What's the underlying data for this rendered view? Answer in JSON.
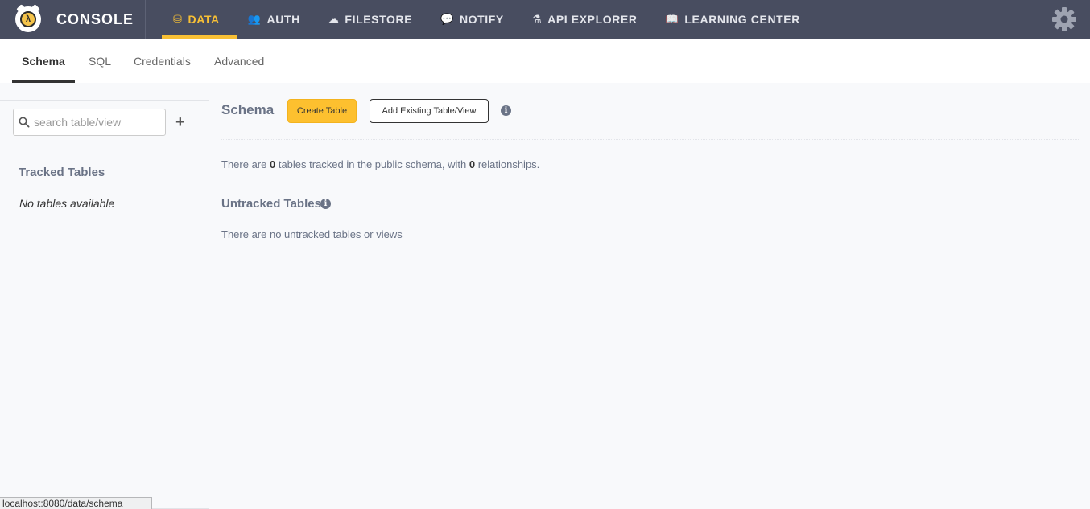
{
  "app": {
    "brand": "CONSOLE"
  },
  "topnav": [
    {
      "label": "DATA",
      "icon": "database-icon",
      "glyph": "⛁",
      "active": true
    },
    {
      "label": "AUTH",
      "icon": "users-icon",
      "glyph": "👥",
      "active": false
    },
    {
      "label": "FILESTORE",
      "icon": "cloud-upload-icon",
      "glyph": "☁",
      "active": false
    },
    {
      "label": "NOTIFY",
      "icon": "comment-icon",
      "glyph": "💬",
      "active": false
    },
    {
      "label": "API EXPLORER",
      "icon": "flask-icon",
      "glyph": "⚗",
      "active": false
    },
    {
      "label": "LEARNING CENTER",
      "icon": "book-icon",
      "glyph": "📖",
      "active": false
    }
  ],
  "subtabs": [
    {
      "label": "Schema",
      "active": true
    },
    {
      "label": "SQL",
      "active": false
    },
    {
      "label": "Credentials",
      "active": false
    },
    {
      "label": "Advanced",
      "active": false
    }
  ],
  "sidebar": {
    "search_placeholder": "search table/view",
    "add_label": "+",
    "tracked_title": "Tracked Tables",
    "empty_text": "No tables available"
  },
  "main": {
    "title": "Schema",
    "create_label": "Create Table",
    "add_existing_label": "Add Existing Table/View",
    "summary": {
      "prefix": "There are ",
      "table_count": "0",
      "middle": " tables tracked in the public schema, with ",
      "relationship_count": "0",
      "suffix": " relationships."
    },
    "untracked_title": "Untracked Tables",
    "untracked_message": "There are no untracked tables or views"
  },
  "statusbar": {
    "url": "localhost:8080/data/schema"
  },
  "colors": {
    "topbar": "#484d60",
    "accent": "#f8c035",
    "create_button": "#fdc02f",
    "muted_text": "#6a7386"
  }
}
